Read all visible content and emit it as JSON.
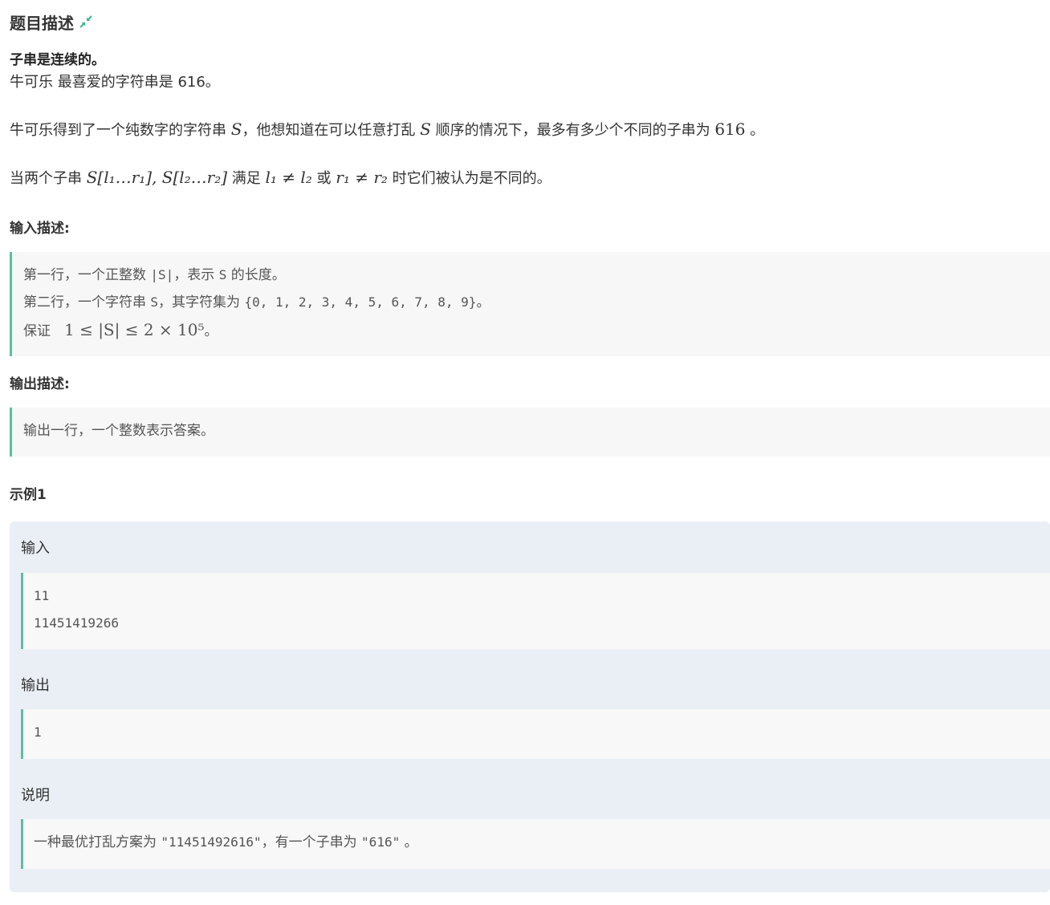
{
  "header": {
    "title": "题目描述"
  },
  "description": {
    "bold_line": "子串是连续的。",
    "line1": "牛可乐 最喜爱的字符串是 616。",
    "line2_pre": "牛可乐得到了一个纯数字的字符串 ",
    "line2_var1": "S",
    "line2_mid": "，他想知道在可以任意打乱 ",
    "line2_var2": "S",
    "line2_post": " 顺序的情况下，最多有多少个不同的子串为 ",
    "line2_num": "616",
    "line2_end": " 。",
    "line3_pre": "当两个子串 ",
    "line3_math1": "S[l₁…r₁], S[l₂…r₂]",
    "line3_mid1": " 满足 ",
    "line3_math2": "l₁ ≠ l₂",
    "line3_mid2": " 或 ",
    "line3_math3": "r₁ ≠ r₂",
    "line3_post": " 时它们被认为是不同的。"
  },
  "input_section": {
    "heading": "输入描述:",
    "line1_pre": "第一行，一个正整数 ",
    "line1_code1": "|S|",
    "line1_mid": "，表示 ",
    "line1_code2": "S",
    "line1_post": " 的长度。",
    "line2_pre": "第二行，一个字符串 ",
    "line2_code1": "S",
    "line2_mid": "，其字符集为 ",
    "line2_code2": "{0, 1, 2, 3, 4, 5, 6, 7, 8, 9}",
    "line2_post": "。",
    "line3_pre": "保证　",
    "line3_math": "1 ≤ |S| ≤ 2 × 10⁵",
    "line3_post": "。"
  },
  "output_section": {
    "heading": "输出描述:",
    "line1": "输出一行，一个整数表示答案。"
  },
  "example": {
    "heading": "示例1",
    "input_label": "输入",
    "input_lines": [
      "11",
      "11451419266"
    ],
    "output_label": "输出",
    "output_lines": [
      "1"
    ],
    "explain_label": "说明",
    "explain_pre": "一种最优打乱方案为 ",
    "explain_code1": "\"11451492616\"",
    "explain_mid": "，有一个子串为 ",
    "explain_code2": "\"616\"",
    "explain_post": " 。"
  },
  "icons": {
    "collapse": "collapse-arrows-icon"
  },
  "colors": {
    "accent": "#5bbf9e",
    "example_bg": "#eaeef5",
    "quote_bg": "#f7f7f7"
  }
}
